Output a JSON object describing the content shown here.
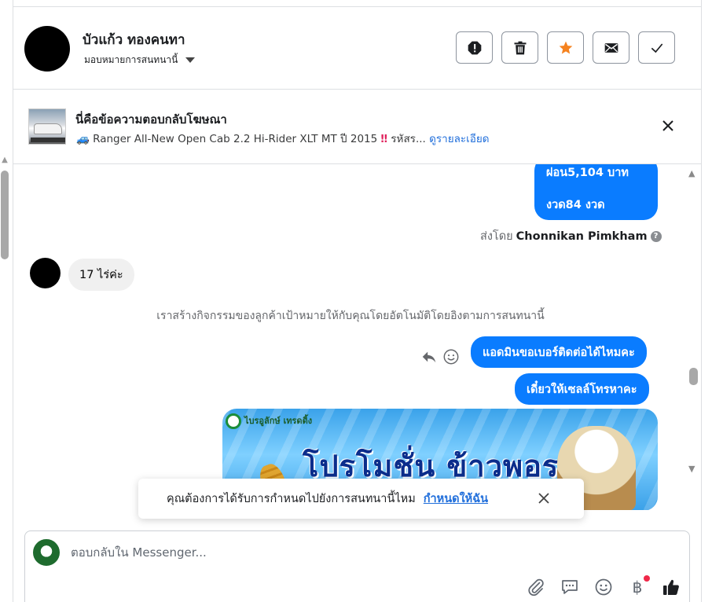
{
  "header": {
    "contact_name": "บัวแก้ว ทองคนทา",
    "assign_label": "มอบหมายการสนทนานี้",
    "actions": [
      "spam",
      "delete",
      "star",
      "mark-unread",
      "done"
    ]
  },
  "ad_reply": {
    "title": "นี่คือข้อความตอบกลับโฆษณา",
    "emoji": "🚙",
    "description": "Ranger All-New Open Cab 2.2 Hi-Rider XLT MT ปี 2015",
    "warning": "‼",
    "truncated": "รหัสร...",
    "details_link": "ดูรายละเอียด"
  },
  "messages": {
    "outgoing_1_line1": "ผ่อน5,104 บาท",
    "outgoing_1_line2": "งวด84 งวด",
    "sent_by_prefix": "ส่งโดย",
    "sent_by_name": "Chonnikan Pimkham",
    "help": "?",
    "incoming_1": "17 ไร่ค่ะ",
    "system_note": "เราสร้างกิจกรรมของลูกค้าเป้าหมายให้กับคุณโดยอัตโนมัติโดยอิงตามการสนทนานี้",
    "outgoing_2": "แอดมินขอเบอร์ติดต่อได้ไหมคะ",
    "outgoing_3": "เดี๋ยวให้เซลล์โทรหาคะ",
    "promo_brand": "ไบรอูลักษ์ เทรดดิ้ง",
    "promo_headline": "โปรโมชั่น ข้าวพอรวย!"
  },
  "toast": {
    "question": "คุณต้องการได้รับการกำหนดไปยังการสนทนานี้ไหม",
    "assign_me": "กำหนดให้ฉัน"
  },
  "composer": {
    "placeholder": "ตอบกลับใน Messenger...",
    "currency": "฿"
  },
  "colors": {
    "accent": "#0a7cff",
    "link": "#216fdb",
    "star": "#f5821f",
    "notification": "#f02849"
  }
}
